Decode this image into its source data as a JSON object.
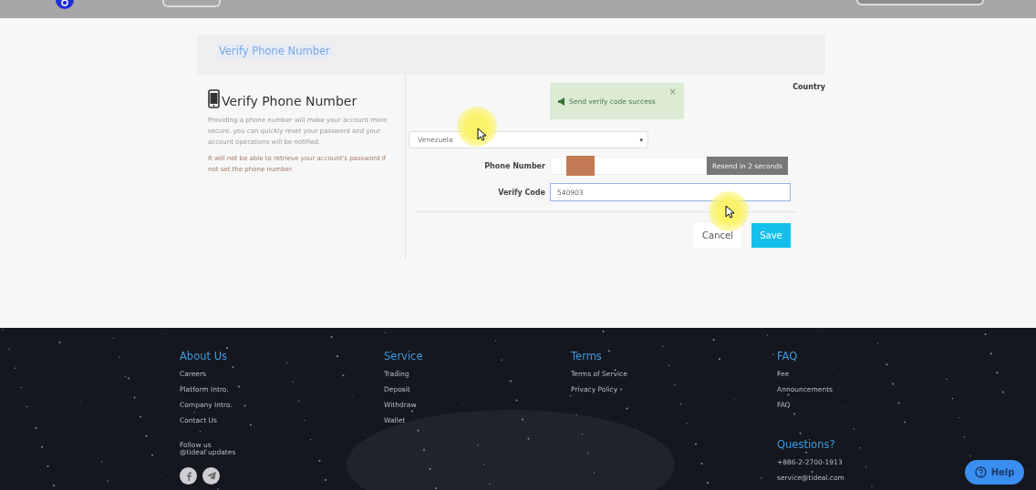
{
  "card": {
    "header_title": "Verify Phone Number",
    "title": "Verify Phone Number",
    "description": "Providing a phone number will make your account more secure. you can quickly reset your password and your account operations will be notified.",
    "warning": "It will not be able to retrieve your account's password if not set the phone number."
  },
  "form": {
    "alert": {
      "text": "Send verify code success",
      "close": "×"
    },
    "country_label": "Country",
    "country_value": "Venezuela",
    "caret": "▾",
    "phone_label": "Phone Number",
    "phone_redacted": true,
    "resend_button": "Resend in 2 seconds",
    "resend_disabled": true,
    "code_label": "Verify Code",
    "code_value": "540903",
    "cancel_button": "Cancel",
    "save_button": "Save"
  },
  "footer": {
    "columns": [
      {
        "title": "About Us",
        "links": [
          "Careers",
          "Platform Intro.",
          "Company Intro.",
          "Contact Us"
        ]
      },
      {
        "title": "Service",
        "links": [
          "Trading",
          "Deposit",
          "Withdraw",
          "Wallet"
        ]
      },
      {
        "title": "Terms",
        "links": [
          "Terms of Service",
          "Privacy Policy"
        ]
      },
      {
        "title": "FAQ",
        "links": [
          "Fee",
          "Announcements",
          "FAQ"
        ]
      }
    ],
    "follow": "Follow us\n@tideal updates",
    "questions_title": "Questions?",
    "phone": "+886-2-2700-1913",
    "email": "service@tideal.com"
  },
  "help_button": "Help"
}
